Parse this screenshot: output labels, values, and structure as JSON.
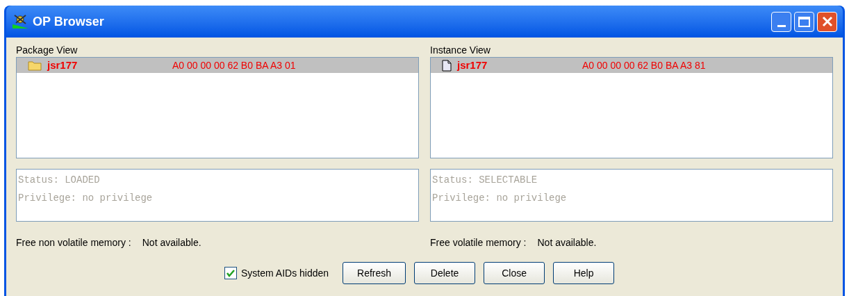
{
  "window": {
    "title": "OP Browser"
  },
  "panels": [
    {
      "heading": "Package View",
      "rows": [
        {
          "kind": "folder",
          "name": "jsr177",
          "aid": "A0 00 00 00 62 B0 BA A3 01",
          "selected": true
        }
      ],
      "status_lines": [
        "Status: LOADED",
        "Privilege: no privilege"
      ],
      "memory_label": "Free non volatile memory :",
      "memory_value": "Not available."
    },
    {
      "heading": "Instance View",
      "rows": [
        {
          "kind": "file",
          "name": "jsr177",
          "aid": "A0 00 00 00 62 B0 BA A3 81",
          "selected": true
        }
      ],
      "status_lines": [
        "Status: SELECTABLE",
        "Privilege: no privilege"
      ],
      "memory_label": "Free volatile memory :",
      "memory_value": "Not available."
    }
  ],
  "checkbox": {
    "label": "System AIDs hidden",
    "checked": true
  },
  "buttons": [
    "Refresh",
    "Delete",
    "Close",
    "Help"
  ]
}
